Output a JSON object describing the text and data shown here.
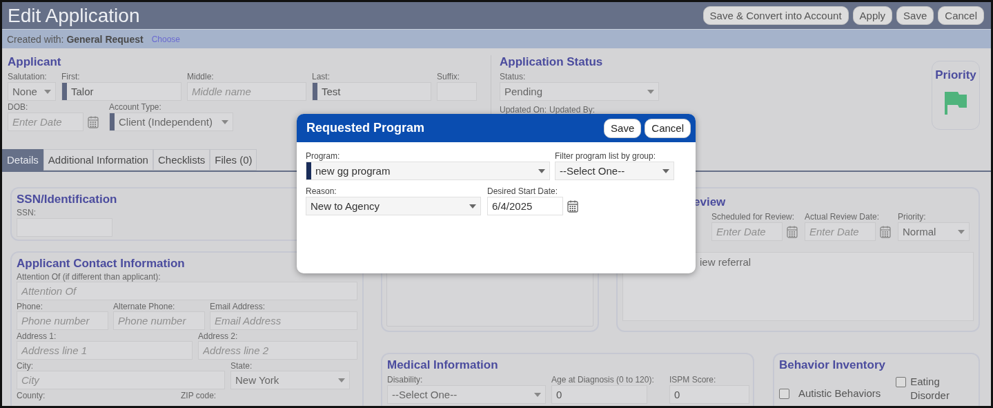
{
  "header": {
    "title": "Edit Application",
    "buttons": [
      "Save & Convert into Account",
      "Apply",
      "Save",
      "Cancel"
    ]
  },
  "created_with": {
    "label": "Created with:",
    "template": "General Request",
    "link": "Choose"
  },
  "applicant": {
    "heading": "Applicant",
    "rows": [
      [
        {
          "label": "Salutation:",
          "kind": "select",
          "value": "None",
          "required": false
        },
        {
          "label": "First:",
          "kind": "text",
          "value": "Talor",
          "required": true
        },
        {
          "label": "Middle:",
          "kind": "text",
          "placeholder": "Middle name",
          "required": false
        },
        {
          "label": "Last:",
          "kind": "text",
          "value": "Test",
          "required": true
        },
        {
          "label": "Suffix:",
          "kind": "text",
          "required": false
        }
      ],
      [
        {
          "label": "DOB:",
          "kind": "date",
          "placeholder": "Enter Date",
          "required": false
        },
        {
          "label": "Account Type:",
          "kind": "select",
          "value": "Client (Independent)",
          "required": true
        }
      ]
    ]
  },
  "application_status": {
    "heading": "Application Status",
    "status": {
      "label": "Status:",
      "kind": "select",
      "value": "Pending"
    },
    "updated_labels": [
      "Updated On:",
      "Updated By:"
    ]
  },
  "priority_card": {
    "heading": "Priority"
  },
  "tabs": [
    {
      "label": "Details",
      "selected": true
    },
    {
      "label": "Additional Information",
      "selected": false
    },
    {
      "label": "Checklists",
      "selected": false
    },
    {
      "label": "Files (0)",
      "selected": false
    }
  ],
  "ssn": {
    "heading": "SSN/Identification",
    "field": {
      "label": "SSN:",
      "kind": "text"
    }
  },
  "contact": {
    "heading": "Applicant Contact Information",
    "rows": [
      [
        {
          "label": "Attention Of (if different than applicant):",
          "kind": "text",
          "placeholder": "Attention Of"
        }
      ],
      [
        {
          "label": "Phone:",
          "kind": "text",
          "placeholder": "Phone number"
        },
        {
          "label": "Alternate Phone:",
          "kind": "text",
          "placeholder": "Phone number"
        },
        {
          "label": "Email Address:",
          "kind": "text",
          "placeholder": "Email Address"
        }
      ],
      [
        {
          "label": "Address 1:",
          "kind": "text",
          "placeholder": "Address line 1"
        },
        {
          "label": "Address 2:",
          "kind": "text",
          "placeholder": "Address line 2"
        }
      ],
      [
        {
          "label": "City:",
          "kind": "text",
          "placeholder": "City"
        },
        {
          "label": "State:",
          "kind": "select",
          "value": "New York"
        }
      ],
      [
        {
          "label": "County:",
          "kind": "none"
        },
        {
          "label": "ZIP code:",
          "kind": "none"
        }
      ]
    ]
  },
  "review": {
    "heading": "eview",
    "fields": [
      {
        "label": "Scheduled for Review:",
        "kind": "date",
        "placeholder": "Enter Date"
      },
      {
        "label": "Actual Review Date:",
        "kind": "date",
        "placeholder": "Enter Date"
      },
      {
        "label": "Priority:",
        "kind": "select",
        "value": "Normal"
      }
    ],
    "notes": {
      "kind": "area",
      "value": "iew referral"
    }
  },
  "medical": {
    "heading": "Medical Information",
    "fields": [
      {
        "label": "Disability:",
        "kind": "select",
        "value": "--Select One--"
      },
      {
        "label": "Age at Diagnosis (0 to 120):",
        "kind": "text",
        "value": "0"
      },
      {
        "label": "ISPM Score:",
        "kind": "text",
        "value": "0"
      }
    ]
  },
  "behavior": {
    "heading": "Behavior Inventory",
    "items": [
      {
        "label": "Autistic Behaviors",
        "checked": false
      },
      {
        "label": "Eating Disorder",
        "checked": false
      }
    ]
  },
  "modal": {
    "title": "Requested Program",
    "buttons": [
      "Save",
      "Cancel"
    ],
    "rows": [
      [
        {
          "label": "Program:",
          "kind": "select",
          "value": "new gg program",
          "required": true
        },
        {
          "label": "Filter program list by group:",
          "kind": "select",
          "value": "--Select One--",
          "required": false
        }
      ],
      [
        {
          "label": "Reason:",
          "kind": "select",
          "value": "New to Agency",
          "required": false
        },
        {
          "label": "Desired Start Date:",
          "kind": "date",
          "value": "6/4/2025",
          "required": false
        }
      ]
    ]
  }
}
